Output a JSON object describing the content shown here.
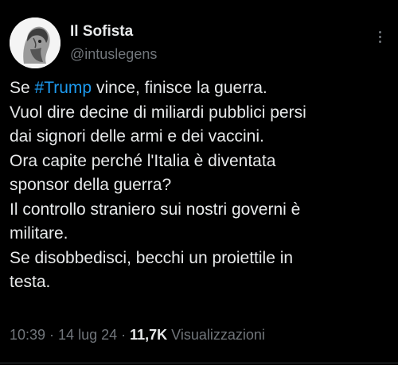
{
  "author": {
    "display_name": "Il Sofista",
    "handle": "@intuslegens",
    "avatar_icon": "bust-avatar-icon"
  },
  "tweet": {
    "lines": [
      {
        "before": "Se ",
        "hashtag": "#Trump",
        "after": " vince, finisce la guerra."
      },
      {
        "text": "Vuol dire decine di miliardi pubblici persi"
      },
      {
        "text": "dai signori delle armi e dei vaccini."
      },
      {
        "text": "Ora capite perché l'Italia è diventata"
      },
      {
        "text": "sponsor della guerra?"
      },
      {
        "text": "Il controllo straniero sui nostri governi è"
      },
      {
        "text": "militare."
      },
      {
        "text": "Se disobbedisci, becchi un proiettile in"
      },
      {
        "text": "testa."
      }
    ]
  },
  "meta": {
    "time": "10:39",
    "sep1": " · ",
    "date": "14 lug 24",
    "sep2": " · ",
    "views_count": "11,7K",
    "views_label": " Visualizzazioni"
  },
  "colors": {
    "background": "#000000",
    "text": "#e7e9ea",
    "secondary": "#71767b",
    "hashtag": "#1d9bf0"
  }
}
